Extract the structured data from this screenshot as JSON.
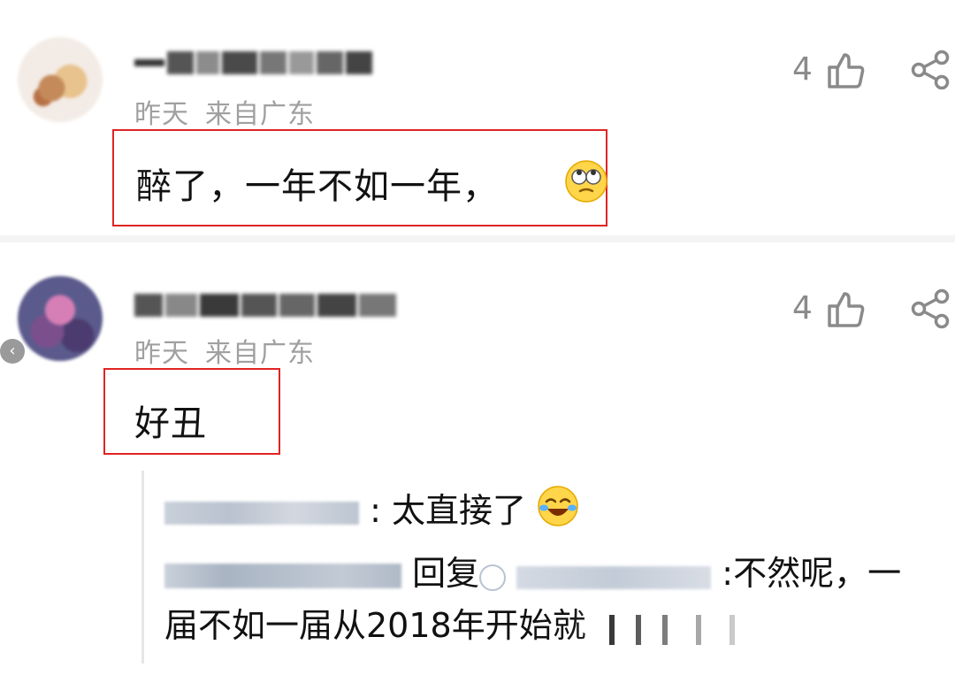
{
  "comments": [
    {
      "time": "昨天",
      "location": "来自广东",
      "text": "醉了，一年不如一年，",
      "like_count": "4",
      "emoji_name": "rolling-eyes-emoji"
    },
    {
      "time": "昨天",
      "location": "来自广东",
      "text": "好丑",
      "like_count": "4",
      "replies": [
        {
          "separator": ":",
          "text": "太直接了"
        },
        {
          "action": "回复",
          "separator": ":",
          "text_line1": "不然呢，一",
          "text_line2": "届不如一届从2018年开始就"
        }
      ]
    }
  ],
  "icons": {
    "like": "thumbs-up-icon",
    "share": "share-icon",
    "back": "chevron-left-icon"
  },
  "colors": {
    "highlight_box": "#e02424",
    "meta_text": "#a0a0a0",
    "count_text": "#8a8a8a"
  }
}
